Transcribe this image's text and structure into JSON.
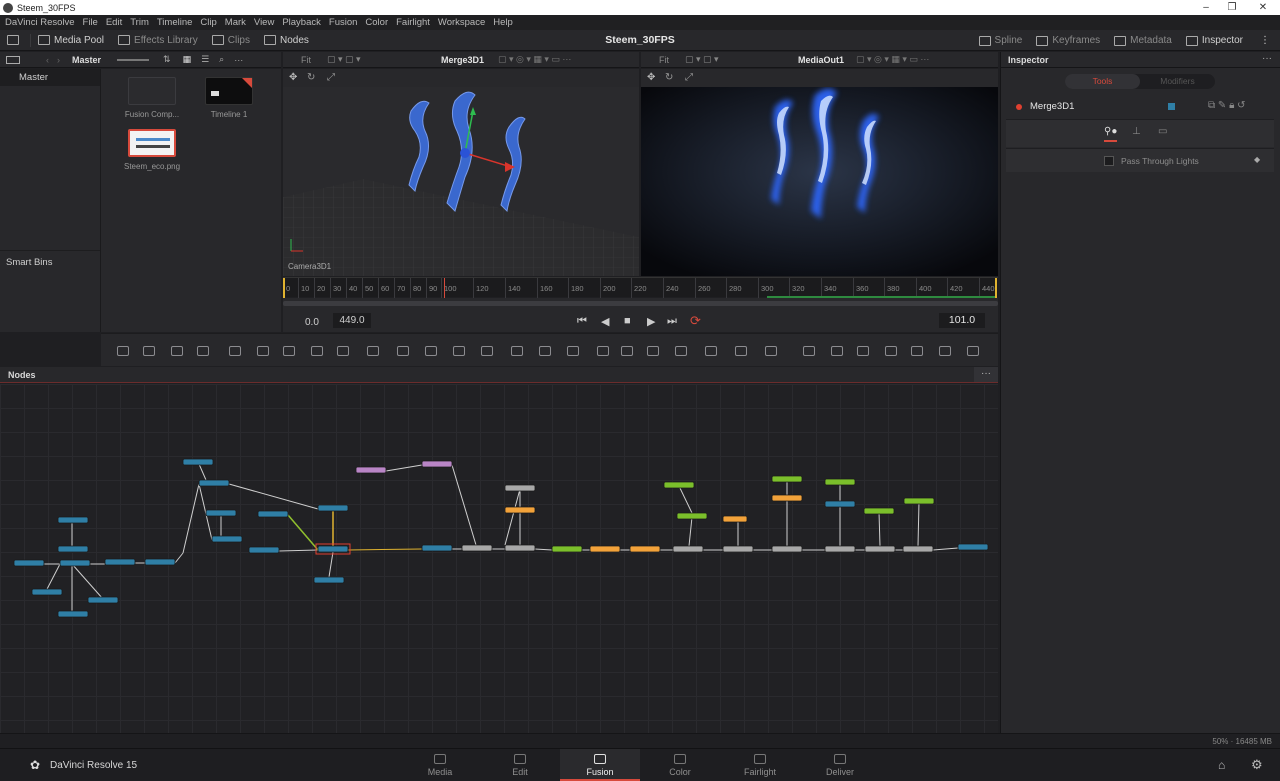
{
  "window": {
    "title": "Steem_30FPS",
    "min": "–",
    "max": "❐",
    "close": "✕"
  },
  "menu": [
    "DaVinci Resolve",
    "File",
    "Edit",
    "Trim",
    "Timeline",
    "Clip",
    "Mark",
    "View",
    "Playback",
    "Fusion",
    "Color",
    "Fairlight",
    "Workspace",
    "Help"
  ],
  "toolbar": {
    "media_pool": "Media Pool",
    "effects_library": "Effects Library",
    "clips": "Clips",
    "nodes": "Nodes",
    "project_title": "Steem_30FPS",
    "spline": "Spline",
    "keyframes": "Keyframes",
    "metadata": "Metadata",
    "inspector": "Inspector"
  },
  "media_pool": {
    "bin_label": "Master",
    "master": "Master",
    "smart_bins": "Smart Bins",
    "clips": [
      {
        "name": "Fusion Comp..."
      },
      {
        "name": "Timeline 1"
      },
      {
        "name": "Steem_eco.png"
      }
    ]
  },
  "viewer_left": {
    "node_name": "Merge3D1",
    "fit": "Fit",
    "camera_label": "Camera3D1"
  },
  "viewer_right": {
    "node_name": "MediaOut1",
    "fit": "Fit"
  },
  "ruler_ticks": [
    "0",
    "10",
    "20",
    "30",
    "40",
    "50",
    "60",
    "70",
    "80",
    "90",
    "100",
    "120",
    "140",
    "160",
    "180",
    "200",
    "220",
    "240",
    "260",
    "280",
    "300",
    "320",
    "340",
    "360",
    "380",
    "400",
    "420",
    "440"
  ],
  "transport": {
    "start": "0.0",
    "end": "449.0",
    "current": "101.0"
  },
  "nodes_panel": {
    "title": "Nodes"
  },
  "inspector": {
    "title": "Inspector",
    "tab_tools": "Tools",
    "tab_modifiers": "Modifiers",
    "node_name": "Merge3D1",
    "checkbox_label": "Pass Through Lights"
  },
  "status": {
    "memory": "50% · 16485 MB"
  },
  "pagebar": {
    "app": "DaVinci Resolve 15",
    "pages": [
      "Media",
      "Edit",
      "Fusion",
      "Color",
      "Fairlight",
      "Deliver"
    ],
    "active": "Fusion"
  },
  "colors": {
    "accent_red": "#d74a3c",
    "node_blue": "#2f7fa6",
    "node_orange": "#f2a23a",
    "node_green": "#7bbf2b",
    "node_pink": "#b985c6",
    "node_gray": "#a8a8a8"
  }
}
